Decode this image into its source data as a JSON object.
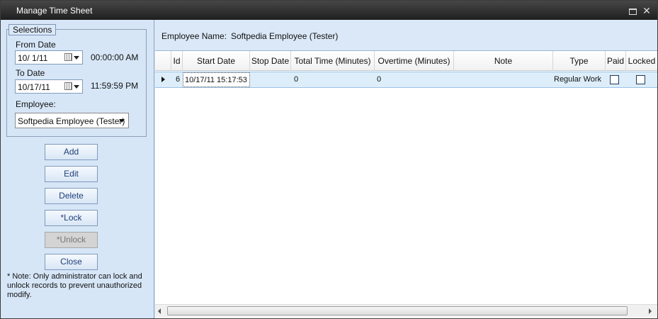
{
  "window": {
    "title": "Manage Time Sheet"
  },
  "selections": {
    "legend": "Selections",
    "from_date_label": "From Date",
    "from_date_value": "10/ 1/11",
    "from_time_value": "00:00:00 AM",
    "to_date_label": "To Date",
    "to_date_value": "10/17/11",
    "to_time_value": "11:59:59 PM",
    "employee_label": "Employee:",
    "employee_value": "Softpedia Employee (Tester)"
  },
  "buttons": {
    "add": "Add",
    "edit": "Edit",
    "delete": "Delete",
    "lock": "*Lock",
    "unlock": "*Unlock",
    "close": "Close"
  },
  "note": "* Note: Only administrator can lock and unlock records to prevent unauthorized modify.",
  "employee_header": {
    "label": "Employee Name:",
    "value": "Softpedia Employee (Tester)"
  },
  "grid": {
    "columns": [
      "Id",
      "Start Date",
      "Stop Date",
      "Total Time (Minutes)",
      "Overtime (Minutes)",
      "Note",
      "Type",
      "Paid",
      "Locked"
    ],
    "rows": [
      {
        "id": "6",
        "start_date": "10/17/11 15:17:53",
        "stop_date": "",
        "total_time": "0",
        "overtime": "0",
        "note": "",
        "type": "Regular Work",
        "paid": false,
        "locked": false
      }
    ]
  },
  "icons": [
    "restore-icon",
    "close-icon",
    "calendar-icon",
    "dropdown-arrow-icon",
    "row-indicator-icon",
    "scroll-left-icon",
    "scroll-right-icon"
  ]
}
